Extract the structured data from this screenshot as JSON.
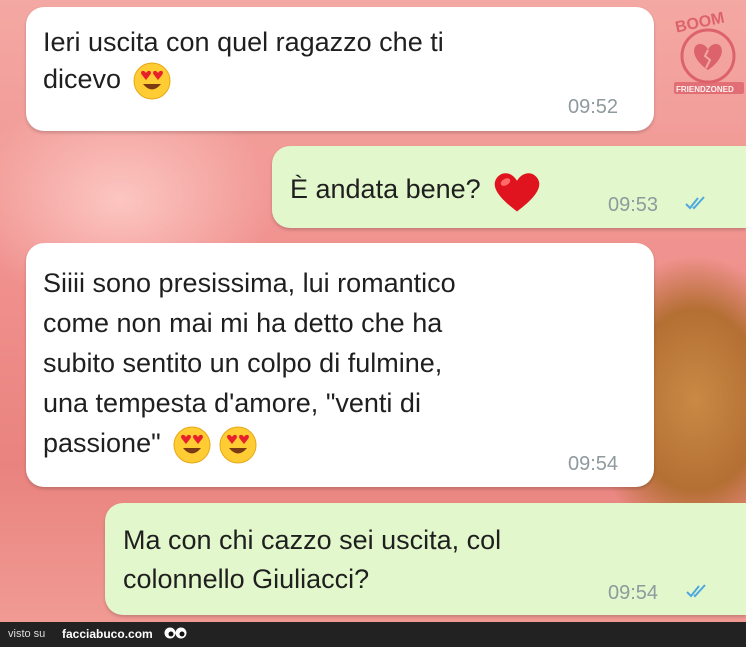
{
  "messages": [
    {
      "direction": "incoming",
      "lines": [
        "Ieri uscita con quel ragazzo che ti",
        "dicevo"
      ],
      "emojis": [
        "heart-eyes"
      ],
      "time": "09:52"
    },
    {
      "direction": "outgoing",
      "lines": [
        "È andata bene?"
      ],
      "emojis": [
        "red-heart"
      ],
      "time": "09:53",
      "status": "read"
    },
    {
      "direction": "incoming",
      "lines": [
        "Siiii sono presissima, lui romantico",
        "come non mai mi ha detto che ha",
        "subito sentito un colpo di fulmine,",
        "una tempesta d'amore, \"venti di",
        "passione\""
      ],
      "emojis": [
        "heart-eyes",
        "heart-eyes"
      ],
      "time": "09:54"
    },
    {
      "direction": "outgoing",
      "lines": [
        "Ma con chi cazzo sei uscita, col",
        "colonnello Giuliacci?"
      ],
      "emojis": [],
      "time": "09:54",
      "status": "read"
    }
  ],
  "watermark": {
    "top": "BOOM",
    "bottom": "FRIENDZONED"
  },
  "footer": {
    "visto": "visto su",
    "brand": "facciabuco.com"
  },
  "colors": {
    "incoming_bubble": "#ffffff",
    "outgoing_bubble": "#e2f7cb",
    "read_ticks": "#4fa8e0",
    "background": "#f0908d"
  }
}
